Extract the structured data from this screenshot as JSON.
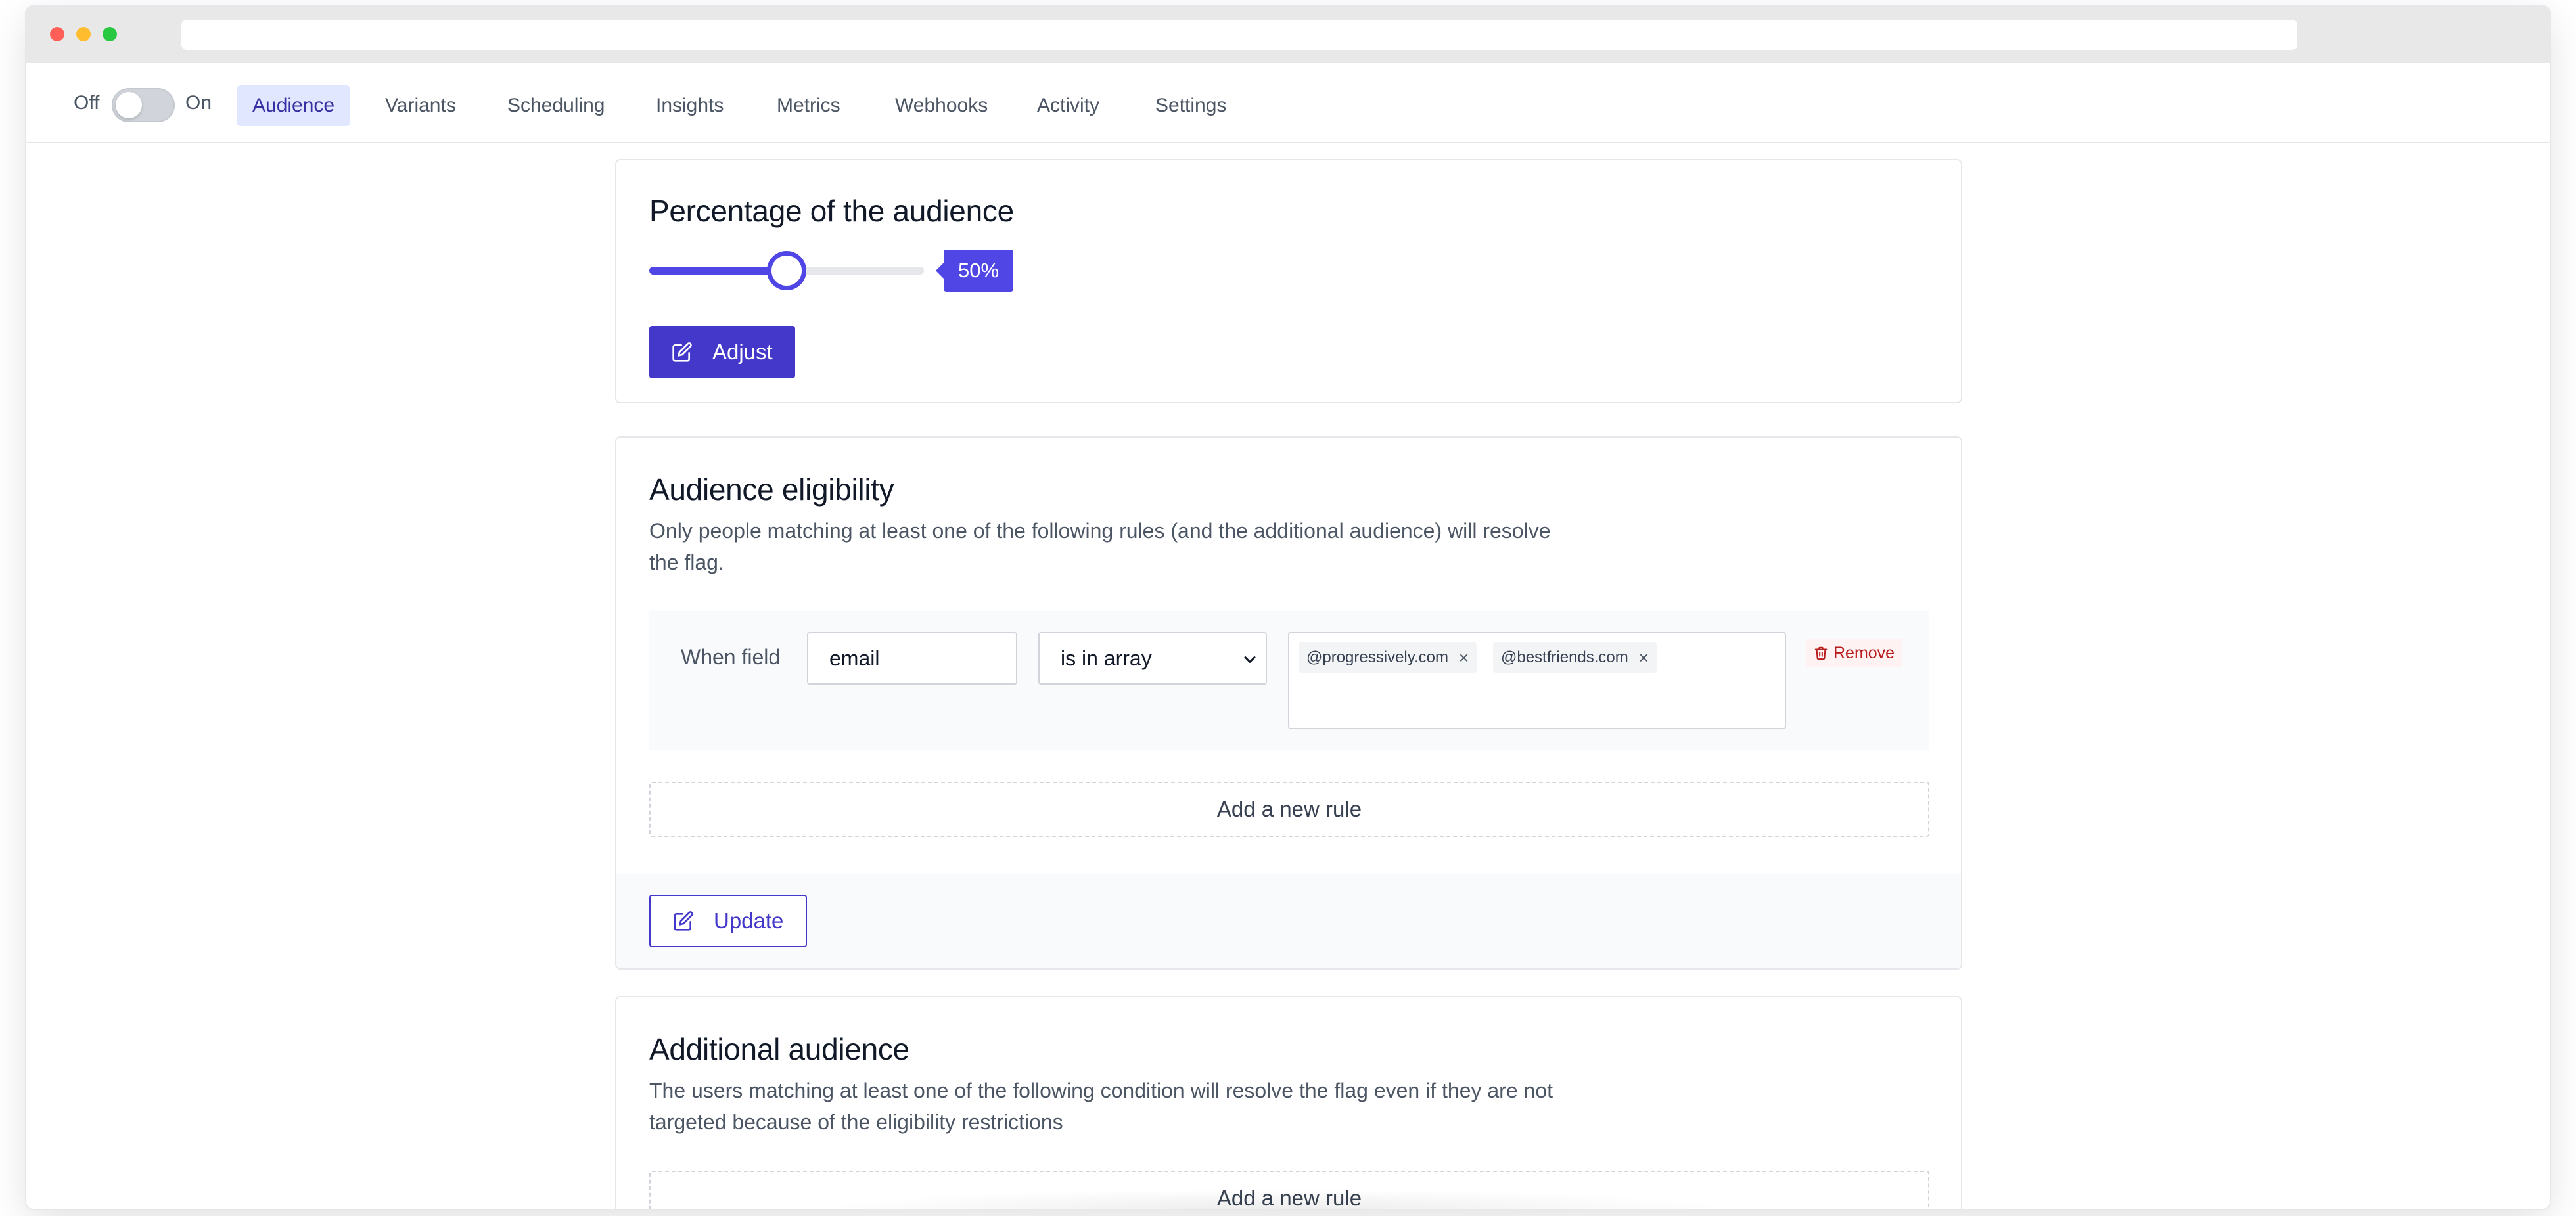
{
  "nav": {
    "toggle_off_label": "Off",
    "toggle_on_label": "On",
    "toggle_state": false,
    "tabs": [
      {
        "label": "Audience",
        "active": true
      },
      {
        "label": "Variants",
        "active": false
      },
      {
        "label": "Scheduling",
        "active": false
      },
      {
        "label": "Insights",
        "active": false
      },
      {
        "label": "Metrics",
        "active": false
      },
      {
        "label": "Webhooks",
        "active": false
      },
      {
        "label": "Activity",
        "active": false
      },
      {
        "label": "Settings",
        "active": false
      }
    ]
  },
  "percentage": {
    "title": "Percentage of the audience",
    "value": 50,
    "value_label": "50%",
    "adjust_label": "Adjust"
  },
  "eligibility": {
    "title": "Audience eligibility",
    "description": "Only people matching at least one of the following rules (and the additional audience) will resolve the flag.",
    "rule": {
      "when_label": "When field",
      "field_value": "email",
      "operator": "is in array",
      "values": [
        "@progressively.com",
        "@bestfriends.com"
      ],
      "remove_label": "Remove"
    },
    "add_rule_label": "Add a new rule",
    "update_label": "Update"
  },
  "additional": {
    "title": "Additional audience",
    "description": "The users matching at least one of the following condition will resolve the flag even if they are not targeted because of the eligibility restrictions",
    "add_rule_label": "Add a new rule"
  },
  "colors": {
    "accent": "#4338ca",
    "accent_light": "#e0e7ff",
    "danger": "#b91c1c"
  }
}
